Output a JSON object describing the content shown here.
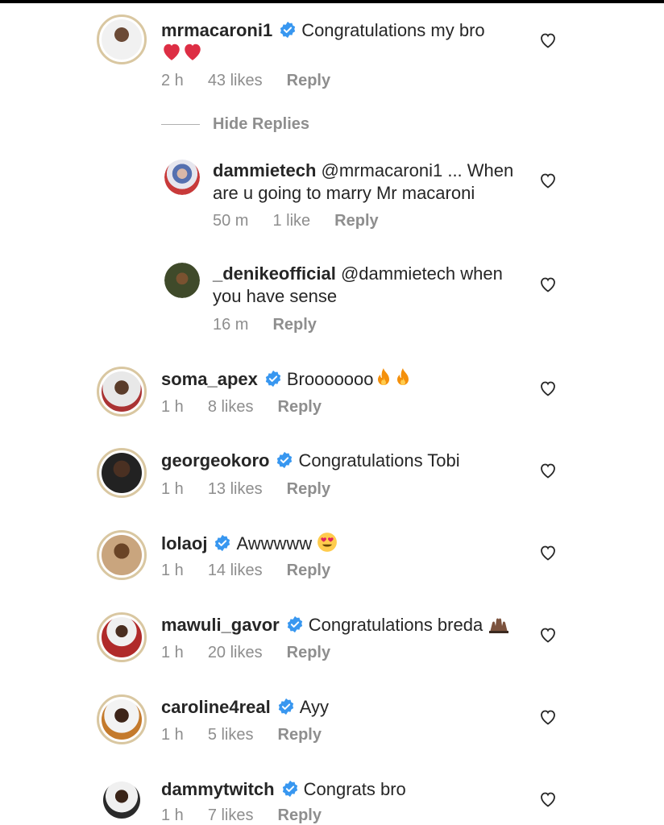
{
  "comments": [
    {
      "user": "mrmacaroni1",
      "verified": true,
      "text": "Congratulations my bro",
      "emoji_line": "❤️❤️",
      "time": "2 h",
      "likes": "43 likes",
      "reply": "Reply"
    },
    {
      "user": "soma_apex",
      "verified": true,
      "text": "Brooooooo",
      "time": "1 h",
      "likes": "8 likes",
      "reply": "Reply"
    },
    {
      "user": "georgeokoro",
      "verified": true,
      "text": "Congratulations Tobi",
      "time": "1 h",
      "likes": "13 likes",
      "reply": "Reply"
    },
    {
      "user": "lolaoj",
      "verified": true,
      "text": "Awwwww",
      "time": "1 h",
      "likes": "14 likes",
      "reply": "Reply"
    },
    {
      "user": "mawuli_gavor",
      "verified": true,
      "text": "Congratulations breda",
      "time": "1 h",
      "likes": "20 likes",
      "reply": "Reply"
    },
    {
      "user": "caroline4real",
      "verified": true,
      "text": "Ayy",
      "time": "1 h",
      "likes": "5 likes",
      "reply": "Reply"
    },
    {
      "user": "dammytwitch",
      "verified": true,
      "text": "Congrats bro",
      "time": "1 h",
      "likes": "7 likes",
      "reply": "Reply"
    }
  ],
  "hide_replies": "Hide Replies",
  "replies": [
    {
      "user": "dammietech",
      "text_line1": "@mrmacaroni1 ... When",
      "text_line2": "are u going to marry Mr macaroni",
      "time": "50 m",
      "likes": "1 like",
      "reply": "Reply"
    },
    {
      "user": "_denikeofficial",
      "text_line1": "@dammietech when",
      "text_line2": "you have sense",
      "time": "16 m",
      "reply": "Reply"
    }
  ],
  "colors": {
    "verified_blue": "#3897f0",
    "meta_gray": "#8e8e8e",
    "heart_red": "#ed4956",
    "fire_orange": "#f4900c"
  }
}
